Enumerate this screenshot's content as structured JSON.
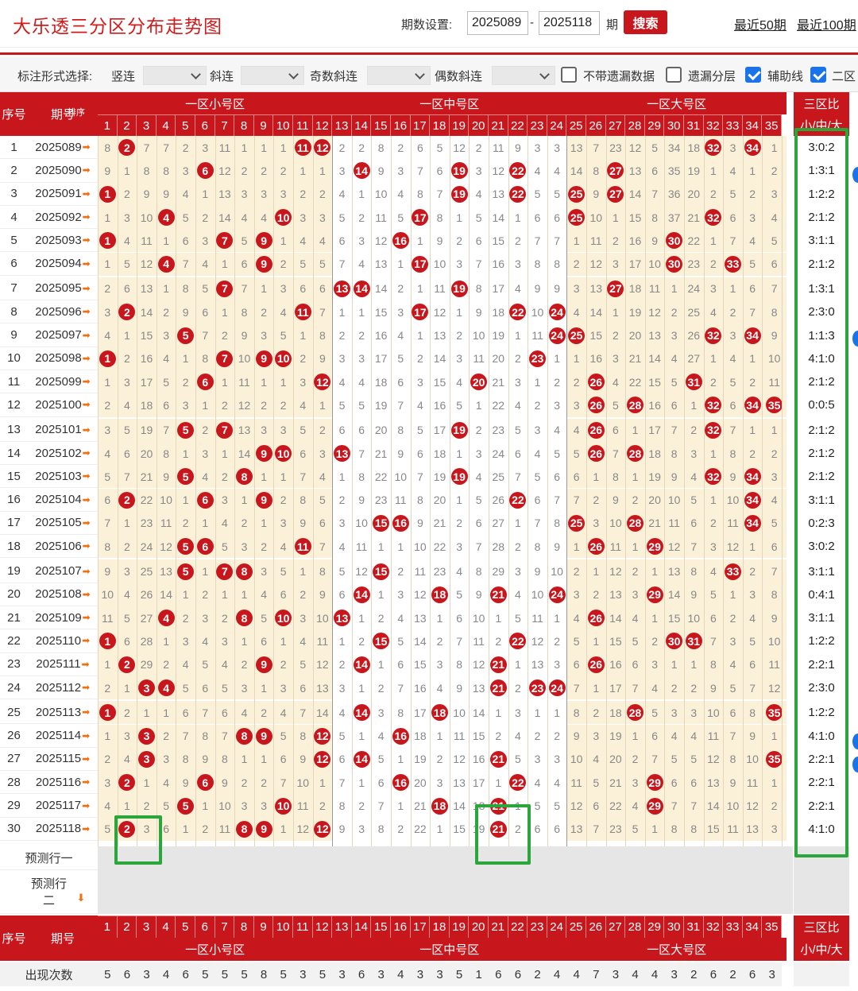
{
  "app": {
    "title": "大乐透三分区分布走势图"
  },
  "period": {
    "label": "期数设置:",
    "start": "2025089",
    "dash": "-",
    "end": "2025118",
    "unit": "期",
    "search": "搜索",
    "recent50": "最近50期",
    "recent100": "最近100期"
  },
  "options": {
    "label": "标注形式选择:",
    "vert": "竖连",
    "diag": "斜连",
    "odd": "奇数斜连",
    "even": "偶数斜连",
    "cb1": "不带遗漏数据",
    "cb2": "遗漏分层",
    "cb3": "辅助线",
    "cb4": "二区"
  },
  "headers": {
    "seq": "序号",
    "issue": "期号",
    "sort": "排序",
    "zone1": "一区小号区",
    "zone2": "一区中号区",
    "zone3": "一区大号区",
    "ratio_top": "三区比",
    "ratio_sub": "小/中/大",
    "predict1": "预测行一",
    "predict2": "预测行",
    "predict2b": "二",
    "count_row": "出现次数"
  },
  "numbers": [
    "1",
    "2",
    "3",
    "4",
    "5",
    "6",
    "7",
    "8",
    "9",
    "10",
    "11",
    "12",
    "13",
    "14",
    "15",
    "16",
    "17",
    "18",
    "19",
    "20",
    "21",
    "22",
    "23",
    "24",
    "25",
    "26",
    "27",
    "28",
    "29",
    "30",
    "31",
    "32",
    "33",
    "34",
    "35"
  ],
  "rows": [
    {
      "n": "1",
      "p": "2025089",
      "r": "3:0:2",
      "v": [
        8,
        "B",
        7,
        7,
        2,
        3,
        11,
        1,
        1,
        1,
        "B",
        "B",
        2,
        2,
        8,
        2,
        6,
        5,
        12,
        2,
        11,
        9,
        3,
        3,
        13,
        7,
        23,
        12,
        5,
        34,
        18,
        "B",
        3,
        "B",
        1
      ]
    },
    {
      "n": "2",
      "p": "2025090",
      "r": "1:3:1",
      "v": [
        9,
        1,
        8,
        8,
        3,
        "B",
        12,
        2,
        2,
        2,
        1,
        1,
        3,
        "B",
        9,
        3,
        7,
        6,
        "B",
        3,
        12,
        "B",
        4,
        4,
        14,
        8,
        "B",
        13,
        6,
        35,
        19,
        1,
        4,
        1,
        2
      ]
    },
    {
      "n": "3",
      "p": "2025091",
      "r": "1:2:2",
      "v": [
        "B",
        2,
        9,
        9,
        4,
        1,
        13,
        3,
        3,
        3,
        2,
        2,
        4,
        1,
        10,
        4,
        8,
        7,
        "B",
        4,
        13,
        "B",
        5,
        5,
        "B",
        9,
        "B",
        14,
        7,
        36,
        20,
        2,
        5,
        2,
        3
      ]
    },
    {
      "n": "4",
      "p": "2025092",
      "r": "2:1:2",
      "v": [
        1,
        3,
        10,
        "B",
        5,
        2,
        14,
        4,
        4,
        "B",
        3,
        3,
        5,
        2,
        11,
        5,
        "B",
        8,
        1,
        5,
        14,
        1,
        6,
        6,
        "B",
        10,
        1,
        15,
        8,
        37,
        21,
        "B",
        6,
        3,
        4
      ]
    },
    {
      "n": "5",
      "p": "2025093",
      "r": "3:1:1",
      "v": [
        "B",
        4,
        11,
        1,
        6,
        3,
        "B",
        5,
        "B",
        1,
        4,
        4,
        6,
        3,
        12,
        "B",
        1,
        9,
        2,
        6,
        15,
        2,
        7,
        7,
        1,
        11,
        2,
        16,
        9,
        "B",
        22,
        1,
        7,
        4,
        5
      ]
    },
    {
      "n": "6",
      "p": "2025094",
      "r": "2:1:2",
      "v": [
        1,
        5,
        12,
        "B",
        7,
        4,
        1,
        6,
        "B",
        2,
        5,
        5,
        7,
        4,
        13,
        1,
        "B",
        10,
        3,
        7,
        16,
        3,
        8,
        8,
        2,
        12,
        3,
        17,
        10,
        "B",
        23,
        2,
        "B",
        5,
        6
      ]
    },
    {
      "n": "7",
      "p": "2025095",
      "r": "1:3:1",
      "v": [
        2,
        6,
        13,
        1,
        8,
        5,
        "B",
        7,
        1,
        3,
        6,
        6,
        "B",
        "B",
        14,
        2,
        1,
        11,
        "B",
        8,
        17,
        4,
        9,
        9,
        3,
        13,
        "B",
        18,
        11,
        1,
        24,
        3,
        1,
        6,
        7
      ]
    },
    {
      "n": "8",
      "p": "2025096",
      "r": "2:3:0",
      "v": [
        3,
        "B",
        14,
        2,
        9,
        6,
        1,
        8,
        2,
        4,
        "B",
        7,
        1,
        1,
        15,
        3,
        "B",
        12,
        1,
        9,
        18,
        "B",
        10,
        "B",
        4,
        14,
        1,
        19,
        12,
        2,
        25,
        4,
        2,
        7,
        8
      ]
    },
    {
      "n": "9",
      "p": "2025097",
      "r": "1:1:3",
      "v": [
        4,
        1,
        15,
        3,
        "B",
        7,
        2,
        9,
        3,
        5,
        1,
        8,
        2,
        2,
        16,
        4,
        1,
        13,
        2,
        10,
        19,
        1,
        11,
        "B",
        "B",
        15,
        2,
        20,
        13,
        3,
        26,
        "B",
        3,
        "B",
        9
      ]
    },
    {
      "n": "10",
      "p": "2025098",
      "r": "4:1:0",
      "v": [
        "B",
        2,
        16,
        4,
        1,
        8,
        "B",
        10,
        "B",
        "B",
        2,
        9,
        3,
        3,
        17,
        5,
        2,
        14,
        3,
        11,
        20,
        2,
        "B",
        1,
        1,
        16,
        3,
        21,
        14,
        4,
        27,
        1,
        4,
        1,
        10
      ]
    },
    {
      "n": "11",
      "p": "2025099",
      "r": "2:1:2",
      "v": [
        1,
        3,
        17,
        5,
        2,
        "B",
        1,
        11,
        1,
        1,
        3,
        "B",
        4,
        4,
        18,
        6,
        3,
        15,
        4,
        "B",
        21,
        3,
        1,
        2,
        2,
        "B",
        4,
        22,
        15,
        5,
        "B",
        2,
        5,
        2,
        11
      ]
    },
    {
      "n": "12",
      "p": "2025100",
      "r": "0:0:5",
      "v": [
        2,
        4,
        18,
        6,
        3,
        1,
        2,
        12,
        2,
        2,
        4,
        1,
        5,
        5,
        19,
        7,
        4,
        16,
        5,
        1,
        22,
        4,
        2,
        3,
        3,
        "B",
        5,
        "B",
        16,
        6,
        1,
        "B",
        6,
        "B",
        "B"
      ]
    },
    {
      "n": "13",
      "p": "2025101",
      "r": "2:1:2",
      "v": [
        3,
        5,
        19,
        7,
        "B",
        2,
        "B",
        13,
        3,
        3,
        5,
        2,
        6,
        6,
        20,
        8,
        5,
        17,
        "B",
        2,
        23,
        5,
        3,
        4,
        4,
        "B",
        6,
        1,
        17,
        7,
        2,
        "B",
        7,
        1,
        1
      ]
    },
    {
      "n": "14",
      "p": "2025102",
      "r": "2:1:2",
      "v": [
        4,
        6,
        20,
        8,
        1,
        3,
        1,
        14,
        "B",
        "B",
        6,
        3,
        "B",
        7,
        21,
        9,
        6,
        18,
        1,
        3,
        24,
        6,
        4,
        5,
        5,
        "B",
        7,
        "B",
        18,
        8,
        3,
        1,
        8,
        2,
        2
      ]
    },
    {
      "n": "15",
      "p": "2025103",
      "r": "2:1:2",
      "v": [
        5,
        7,
        21,
        9,
        "B",
        4,
        2,
        "B",
        1,
        1,
        7,
        4,
        1,
        8,
        22,
        10,
        7,
        19,
        "B",
        4,
        25,
        7,
        5,
        6,
        6,
        1,
        8,
        1,
        19,
        9,
        4,
        "B",
        9,
        "B",
        3
      ]
    },
    {
      "n": "16",
      "p": "2025104",
      "r": "3:1:1",
      "v": [
        6,
        "B",
        22,
        10,
        1,
        "B",
        3,
        1,
        "B",
        2,
        8,
        5,
        2,
        9,
        23,
        11,
        8,
        20,
        1,
        5,
        26,
        "B",
        6,
        7,
        7,
        2,
        9,
        2,
        20,
        10,
        5,
        1,
        10,
        "B",
        4
      ]
    },
    {
      "n": "17",
      "p": "2025105",
      "r": "0:2:3",
      "v": [
        7,
        1,
        23,
        11,
        2,
        1,
        4,
        2,
        1,
        3,
        9,
        6,
        3,
        10,
        "B",
        "B",
        9,
        21,
        2,
        6,
        27,
        1,
        7,
        8,
        "B",
        3,
        10,
        "B",
        21,
        11,
        6,
        2,
        11,
        "B",
        5
      ]
    },
    {
      "n": "18",
      "p": "2025106",
      "r": "3:0:2",
      "v": [
        8,
        2,
        24,
        12,
        "B",
        "B",
        5,
        3,
        2,
        4,
        "B",
        7,
        4,
        11,
        1,
        1,
        10,
        22,
        3,
        7,
        28,
        2,
        8,
        9,
        1,
        "B",
        11,
        1,
        "B",
        12,
        7,
        3,
        12,
        1,
        6
      ]
    },
    {
      "n": "19",
      "p": "2025107",
      "r": "3:1:1",
      "v": [
        9,
        3,
        25,
        13,
        "B",
        1,
        "B",
        "B",
        3,
        5,
        1,
        8,
        5,
        12,
        "B",
        2,
        11,
        23,
        4,
        8,
        29,
        3,
        9,
        10,
        2,
        1,
        12,
        2,
        1,
        13,
        8,
        4,
        "B",
        2,
        7
      ]
    },
    {
      "n": "20",
      "p": "2025108",
      "r": "0:4:1",
      "v": [
        10,
        4,
        26,
        14,
        1,
        2,
        1,
        1,
        4,
        6,
        2,
        9,
        6,
        "B",
        1,
        3,
        12,
        "B",
        5,
        9,
        "B",
        4,
        10,
        "B",
        3,
        2,
        13,
        3,
        "B",
        14,
        9,
        5,
        1,
        3,
        8
      ]
    },
    {
      "n": "21",
      "p": "2025109",
      "r": "3:1:1",
      "v": [
        11,
        5,
        27,
        "B",
        2,
        3,
        2,
        "B",
        5,
        "B",
        3,
        10,
        "B",
        1,
        2,
        4,
        13,
        1,
        6,
        10,
        1,
        5,
        11,
        1,
        4,
        "B",
        14,
        4,
        1,
        15,
        10,
        6,
        2,
        4,
        9
      ]
    },
    {
      "n": "22",
      "p": "2025110",
      "r": "1:2:2",
      "v": [
        "B",
        6,
        28,
        1,
        3,
        4,
        3,
        1,
        6,
        1,
        4,
        11,
        1,
        2,
        "B",
        5,
        14,
        2,
        7,
        11,
        2,
        "B",
        12,
        2,
        5,
        1,
        15,
        5,
        2,
        "B",
        "B",
        7,
        3,
        5,
        10
      ]
    },
    {
      "n": "23",
      "p": "2025111",
      "r": "2:2:1",
      "v": [
        1,
        "B",
        29,
        2,
        4,
        5,
        4,
        2,
        "B",
        2,
        5,
        12,
        2,
        "B",
        1,
        6,
        15,
        3,
        8,
        12,
        "B",
        1,
        13,
        3,
        6,
        "B",
        16,
        6,
        3,
        1,
        1,
        8,
        4,
        6,
        11
      ]
    },
    {
      "n": "24",
      "p": "2025112",
      "r": "2:3:0",
      "v": [
        2,
        1,
        "B",
        "B",
        5,
        6,
        5,
        3,
        1,
        3,
        6,
        13,
        3,
        1,
        2,
        7,
        16,
        4,
        9,
        13,
        "B",
        2,
        "B",
        "B",
        7,
        1,
        17,
        7,
        4,
        2,
        2,
        9,
        5,
        7,
        12
      ]
    },
    {
      "n": "25",
      "p": "2025113",
      "r": "1:2:2",
      "v": [
        "B",
        2,
        1,
        1,
        6,
        7,
        6,
        4,
        2,
        4,
        7,
        14,
        4,
        "B",
        3,
        8,
        17,
        "B",
        10,
        14,
        1,
        3,
        1,
        1,
        8,
        2,
        18,
        "B",
        5,
        3,
        3,
        10,
        6,
        8,
        "B"
      ]
    },
    {
      "n": "26",
      "p": "2025114",
      "r": "4:1:0",
      "v": [
        1,
        3,
        "B",
        2,
        7,
        8,
        7,
        "B",
        "B",
        5,
        8,
        "B",
        5,
        1,
        4,
        "B",
        18,
        1,
        11,
        15,
        2,
        4,
        2,
        2,
        9,
        3,
        19,
        1,
        6,
        4,
        4,
        11,
        7,
        9,
        1
      ]
    },
    {
      "n": "27",
      "p": "2025115",
      "r": "2:2:1",
      "v": [
        2,
        4,
        "B",
        3,
        8,
        9,
        8,
        1,
        1,
        6,
        9,
        "B",
        6,
        "B",
        5,
        1,
        19,
        2,
        12,
        16,
        "B",
        5,
        3,
        3,
        10,
        4,
        20,
        2,
        7,
        5,
        5,
        12,
        8,
        10,
        "B"
      ]
    },
    {
      "n": "28",
      "p": "2025116",
      "r": "2:2:1",
      "v": [
        3,
        "B",
        1,
        4,
        9,
        "B",
        9,
        2,
        2,
        7,
        10,
        1,
        7,
        1,
        6,
        "B",
        20,
        3,
        13,
        17,
        1,
        "B",
        4,
        4,
        11,
        5,
        21,
        3,
        "B",
        6,
        6,
        13,
        9,
        11,
        1
      ]
    },
    {
      "n": "29",
      "p": "2025117",
      "r": "2:2:1",
      "v": [
        4,
        1,
        2,
        5,
        "B",
        1,
        10,
        3,
        3,
        "B",
        11,
        2,
        8,
        2,
        7,
        1,
        21,
        "B",
        14,
        18,
        "B",
        1,
        5,
        5,
        12,
        6,
        22,
        4,
        "B",
        7,
        7,
        14,
        10,
        12,
        2
      ]
    },
    {
      "n": "30",
      "p": "2025118",
      "r": "4:1:0",
      "v": [
        5,
        "B",
        3,
        6,
        1,
        2,
        11,
        "B",
        "B",
        1,
        12,
        "B",
        9,
        3,
        8,
        2,
        22,
        1,
        15,
        19,
        "B",
        2,
        6,
        6,
        13,
        7,
        23,
        5,
        1,
        8,
        8,
        15,
        11,
        13,
        3
      ]
    }
  ],
  "counts": [
    5,
    6,
    3,
    4,
    6,
    5,
    5,
    5,
    8,
    5,
    3,
    5,
    3,
    6,
    3,
    4,
    3,
    3,
    5,
    1,
    6,
    6,
    2,
    4,
    4,
    7,
    3,
    4,
    4,
    3,
    2,
    6,
    2,
    6,
    3
  ]
}
